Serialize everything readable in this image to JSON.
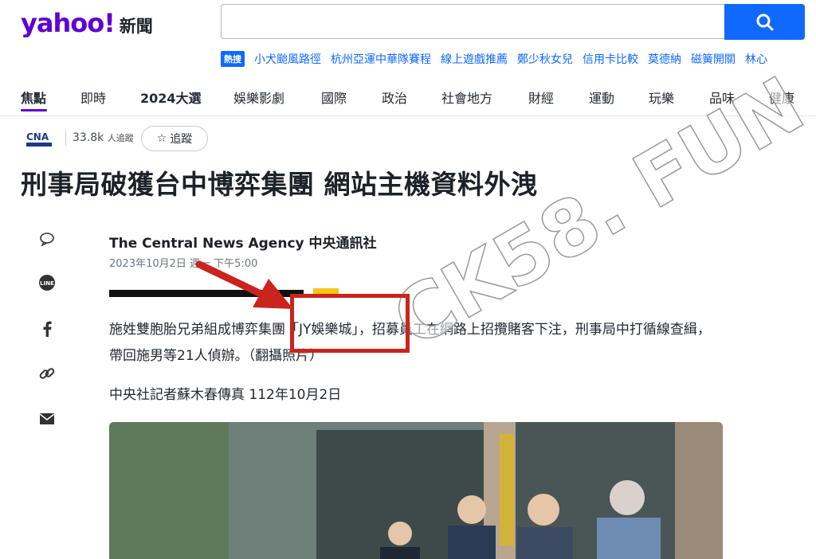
{
  "header": {
    "logo_text": "yahoo!",
    "logo_section": "新聞",
    "search_placeholder": ""
  },
  "trending": {
    "badge": "熱搜",
    "items": [
      "小犬颱風路徑",
      "杭州亞運中華隊賽程",
      "線上遊戲推薦",
      "鄭少秋女兒",
      "信用卡比較",
      "莫德納",
      "磁簧開關",
      "林心"
    ]
  },
  "nav": {
    "items": [
      "焦點",
      "即時",
      "2024大選",
      "娛樂影劇",
      "國際",
      "政治",
      "社會地方",
      "財經",
      "運動",
      "玩樂",
      "品味",
      "健康"
    ],
    "active_index": 0
  },
  "source": {
    "logo_label": "CNA",
    "followers_count": "33.8k",
    "followers_unit": "人追蹤",
    "follow_label": "追蹤"
  },
  "article": {
    "headline": "刑事局破獲台中博弈集團 網站主機資料外洩",
    "provider": "The Central News Agency 中央通訊社",
    "date": "2023年10月2日 週一 下午5:00",
    "paragraph1": "施姓雙胞胎兄弟組成博弈集團「JY娛樂城」，招募員工在網路上招攬賭客下注，刑事局中打循線查緝，帶回施男等21人偵辦。（翻攝照片）",
    "paragraph2": "中央社記者蘇木春傳真 112年10月2日"
  },
  "share": {
    "items": [
      "comment-icon",
      "line-icon",
      "facebook-icon",
      "link-icon",
      "mail-icon"
    ],
    "line_label": "LINE"
  },
  "watermark": {
    "text": "CK58. FUN"
  },
  "colors": {
    "brand": "#6001d2",
    "link": "#0f69ff",
    "annotation": "#c9241d"
  }
}
